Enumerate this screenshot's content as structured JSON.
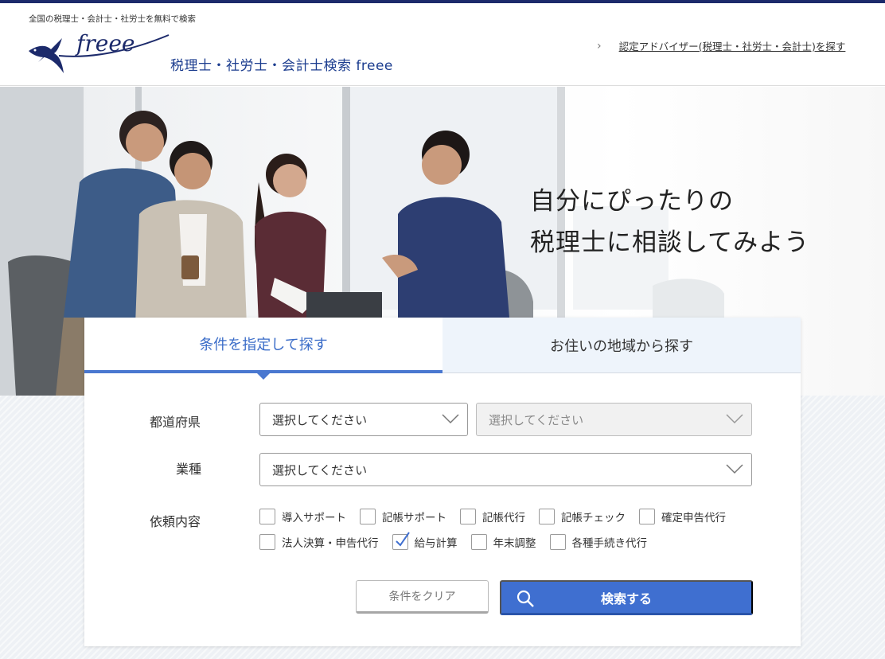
{
  "header": {
    "tagline": "全国の税理士・会計士・社労士を無料で検索",
    "logo_text": "freee",
    "site_name": "税理士・社労士・会計士検索 freee",
    "advisor_link": "認定アドバイザー(税理士・社労士・会計士)を探す"
  },
  "hero": {
    "line1": "自分にぴったりの",
    "line2": "税理士に相談してみよう"
  },
  "tabs": [
    {
      "label": "条件を指定して探す",
      "active": true
    },
    {
      "label": "お住いの地域から探す",
      "active": false
    }
  ],
  "form": {
    "prefecture_label": "都道府県",
    "prefecture_value": "選択してください",
    "city_value": "選択してください",
    "industry_label": "業種",
    "industry_value": "選択してください",
    "request_label": "依頼内容",
    "options_row1": [
      {
        "label": "導入サポート",
        "checked": false
      },
      {
        "label": "記帳サポート",
        "checked": false
      },
      {
        "label": "記帳代行",
        "checked": false
      },
      {
        "label": "記帳チェック",
        "checked": false
      },
      {
        "label": "確定申告代行",
        "checked": false
      }
    ],
    "options_row2": [
      {
        "label": "法人決算・申告代行",
        "checked": false
      },
      {
        "label": "給与計算",
        "checked": true
      },
      {
        "label": "年末調整",
        "checked": false
      },
      {
        "label": "各種手続き代行",
        "checked": false
      }
    ]
  },
  "buttons": {
    "clear": "条件をクリア",
    "search": "検索する"
  },
  "colors": {
    "brand_navy": "#1c2a6b",
    "accent_blue": "#3f6fd0"
  }
}
